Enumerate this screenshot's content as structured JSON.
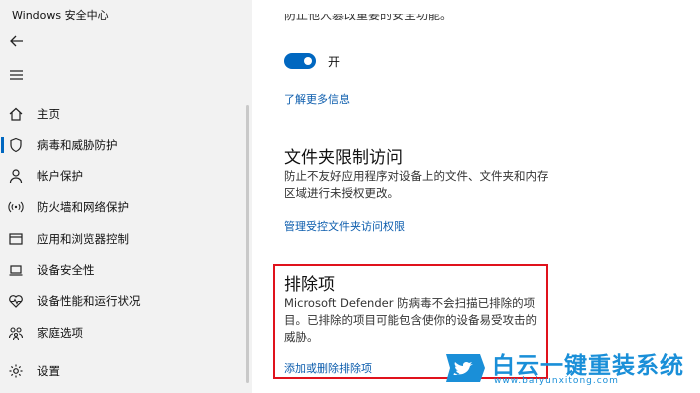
{
  "window": {
    "title": "Windows 安全中心"
  },
  "sidebar": {
    "items": [
      {
        "label": "主页",
        "icon": "home-icon"
      },
      {
        "label": "病毒和威胁防护",
        "icon": "shield-icon",
        "active": true
      },
      {
        "label": "帐户保护",
        "icon": "person-icon"
      },
      {
        "label": "防火墙和网络保护",
        "icon": "wifi-icon"
      },
      {
        "label": "应用和浏览器控制",
        "icon": "window-icon"
      },
      {
        "label": "设备安全性",
        "icon": "laptop-icon"
      },
      {
        "label": "设备性能和运行状况",
        "icon": "heart-icon"
      },
      {
        "label": "家庭选项",
        "icon": "family-icon"
      },
      {
        "label": "设置",
        "icon": "gear-icon"
      }
    ]
  },
  "main": {
    "clipped_text": "防止他人篡改重要的安全功能。",
    "toggle": {
      "state": "on",
      "label": "开"
    },
    "learn_more_link": "了解更多信息",
    "folder_access": {
      "title": "文件夹限制访问",
      "description": "防止不友好应用程序对设备上的文件、文件夹和内存区域进行未授权更改。",
      "link": "管理受控文件夹访问权限"
    },
    "exclusions": {
      "title": "排除项",
      "description": "Microsoft Defender 防病毒不会扫描已排除的项目。已排除的项目可能包含使你的设备易受攻击的威胁。",
      "link": "添加或删除排除项"
    }
  },
  "watermark": {
    "text": "白云一键重装系统",
    "url": "www.baiyunxitong.com"
  },
  "colors": {
    "accent": "#0067c0",
    "highlight": "#e0121c",
    "watermark": "#1a8fd8"
  }
}
